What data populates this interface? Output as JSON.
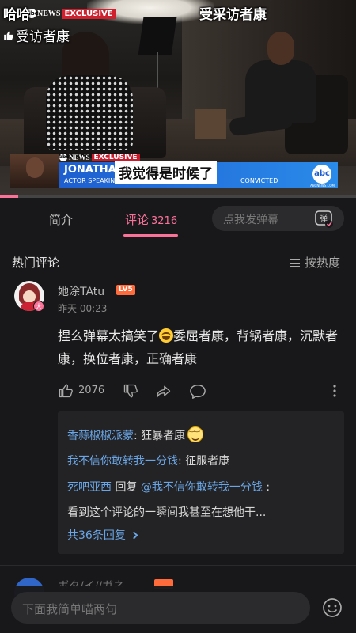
{
  "video": {
    "overlay_top_left": "哈哈",
    "overlay_top_right": "受采访者康",
    "overlay_sub": "受访者康",
    "news_logo": {
      "abc": "abc",
      "news": "NEWS",
      "exclusive": "EXCLUSIVE"
    },
    "lower_third": {
      "tag_abc": "abc",
      "tag_news": "NEWS",
      "tag_exclusive": "EXCLUSIVE",
      "name": "JONATHAN",
      "desc_left": "ACTOR SPEAKING",
      "desc_right": "CONVICTED",
      "abc_logo": "abc",
      "abc_sub": "ABCNEWS.COM"
    },
    "subtitle": "我觉得是时候了",
    "progress": 0.05,
    "accent_color": "#fb7299"
  },
  "tabs": {
    "intro_label": "简介",
    "comments_label": "评论",
    "comments_count": "3216",
    "danmaku_placeholder": "点我发弹幕",
    "danmaku_icon": "弹"
  },
  "hot_comments": {
    "title": "热门评论",
    "sort_label": "按热度"
  },
  "comment": {
    "username": "她涂TAtu",
    "level": "LV5",
    "avatar_badge": "大",
    "time": "昨天 00:23",
    "text_part1": "捏么弹幕太搞笑了",
    "text_part2": "委屈者康，背锅者康，沉默者康，换位者康，正确者康",
    "likes": "2076"
  },
  "replies": [
    {
      "user": "香蒜椒椒派蒙",
      "sep": ": ",
      "text": "狂暴者康"
    },
    {
      "user": "我不信你敢转我一分钱",
      "sep": ": ",
      "text": "征服者康"
    },
    {
      "user": "死吧亚西",
      "mid": " 回复 ",
      "target": "@我不信你敢转我一分钱",
      "sep": " :"
    },
    {
      "text": "看到这个评论的一瞬间我甚至在想他干..."
    }
  ],
  "more_replies": "共36条回复",
  "next_comment": {
    "username": "ボタ/イ//ガネ"
  },
  "bottom": {
    "input_placeholder": "下面我简单喵两句"
  }
}
